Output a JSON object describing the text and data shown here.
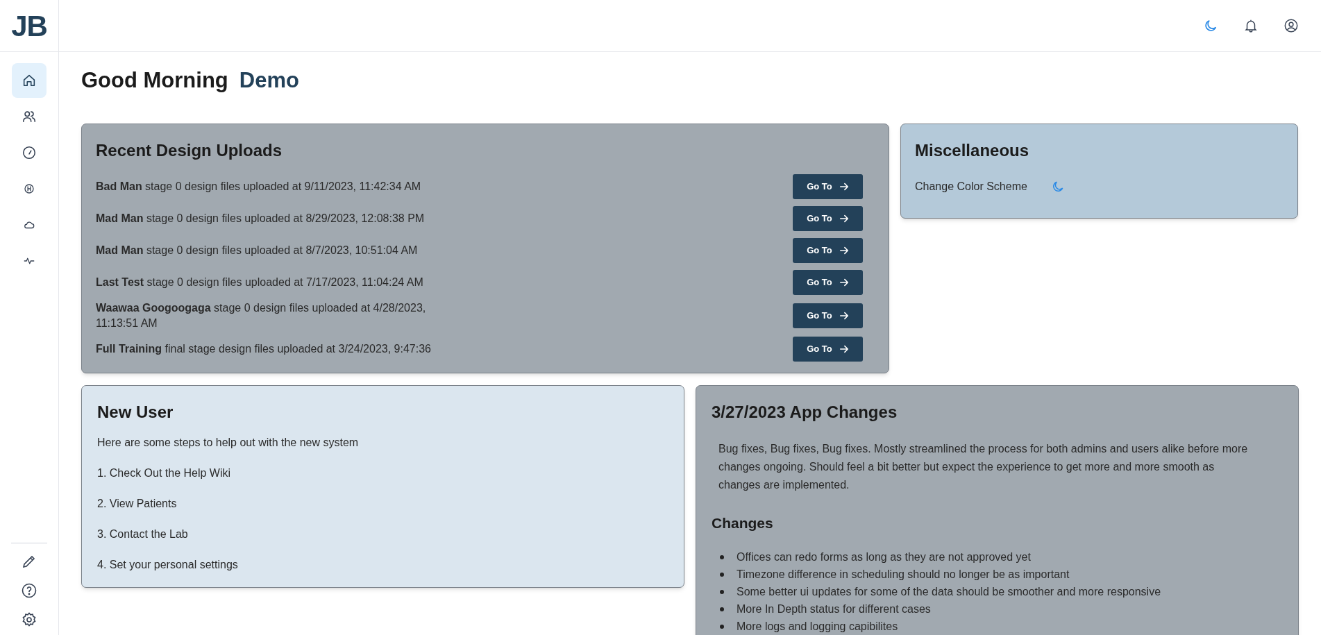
{
  "logo": "JB",
  "sidebar": {
    "items": [
      {
        "selected": true
      },
      {
        "selected": false
      },
      {
        "selected": false
      },
      {
        "selected": false
      },
      {
        "selected": false
      },
      {
        "selected": false
      }
    ]
  },
  "greeting": {
    "text": "Good Morning",
    "user": "Demo"
  },
  "recent_uploads": {
    "title": "Recent Design Uploads",
    "rows": [
      {
        "text": "**Bad Man** stage 0 design files uploaded at 9/11/2023, 11:42:34 AM",
        "button": "Go To"
      },
      {
        "text": "**Mad Man** stage 0 design files uploaded at 8/29/2023, 12:08:38 PM",
        "button": "Go To"
      },
      {
        "text": "**Mad Man** stage 0 design files uploaded at 8/7/2023, 10:51:04 AM",
        "button": "Go To"
      },
      {
        "text": "**Last Test** stage 0 design files uploaded at 7/17/2023, 11:04:24 AM",
        "button": "Go To"
      },
      {
        "text": "**Waawaa Googoogaga** stage 0 design files uploaded at 4/28/2023, 11:13:51 AM",
        "button": "Go To"
      },
      {
        "text": "**Full Training** final stage design files uploaded at 3/24/2023, 9:47:36",
        "button": "Go To"
      }
    ]
  },
  "misc": {
    "title": "Miscellaneous",
    "items": [
      {
        "label": "Change Color Scheme"
      }
    ]
  },
  "new_user": {
    "title": "New User",
    "intro": "Here are some steps to help out with the new system",
    "steps": [
      "1. Check Out the Help Wiki",
      "2. View Patients",
      "3. Contact the Lab",
      "4. Set your personal settings"
    ]
  },
  "app_changes": {
    "title": "3/27/2023 App Changes",
    "summary": "Bug fixes, Bug fixes, Bug fixes. Mostly streamlined the process for both admins and users alike before more changes ongoing. Should feel a bit better but expect the experience to get more and more smooth as changes are implemented.",
    "subtitle": "Changes",
    "items": [
      "Offices can redo forms as long as they are not approved yet",
      "Timezone difference in scheduling should no longer be as important",
      "Some better ui updates for some of the data should be smoother and more responsive",
      "More In Depth status for different cases",
      "More logs and logging capibilites"
    ]
  }
}
